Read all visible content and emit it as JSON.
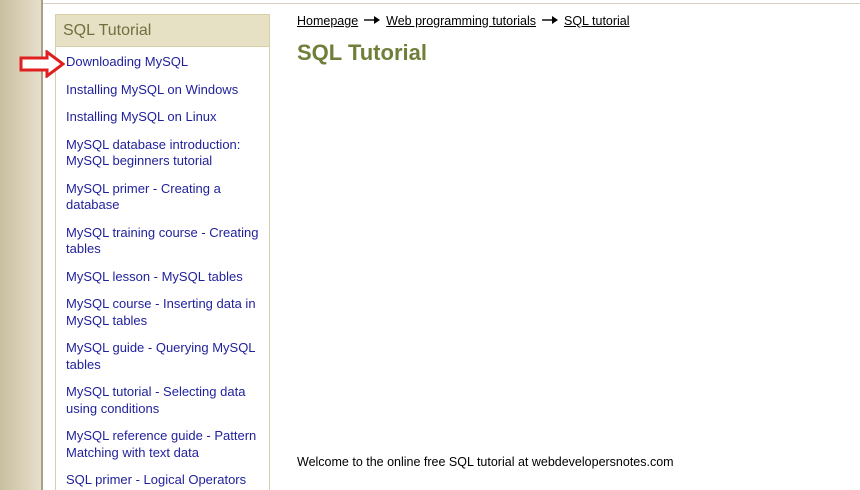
{
  "sidebar": {
    "title": "SQL Tutorial",
    "items": [
      {
        "label": "Downloading MySQL"
      },
      {
        "label": "Installing MySQL on Windows"
      },
      {
        "label": "Installing MySQL on Linux"
      },
      {
        "label": "MySQL database introduction: MySQL beginners tutorial"
      },
      {
        "label": "MySQL primer - Creating a database"
      },
      {
        "label": "MySQL training course - Creating tables"
      },
      {
        "label": "MySQL lesson - MySQL tables"
      },
      {
        "label": "MySQL course - Inserting data in MySQL tables"
      },
      {
        "label": "MySQL guide - Querying MySQL tables"
      },
      {
        "label": "MySQL tutorial - Selecting data using conditions"
      },
      {
        "label": "MySQL reference guide - Pattern Matching with text data"
      },
      {
        "label": "SQL primer - Logical Operators"
      }
    ]
  },
  "annotation": {
    "icon": "red-arrow-right-icon",
    "color": "#e02020"
  },
  "breadcrumb": {
    "items": [
      {
        "label": "Homepage"
      },
      {
        "label": "Web programming tutorials"
      },
      {
        "label": "SQL tutorial"
      }
    ],
    "separator_icon": "long-arrow-right-icon"
  },
  "main": {
    "title": "SQL Tutorial",
    "welcome": "Welcome to the online free SQL tutorial at webdevelopersnotes.com"
  },
  "colors": {
    "link": "#1f1f9b",
    "title": "#6f7f3a",
    "sidebar_header_bg": "#e6e1c4",
    "sidebar_header_text": "#6f6f3f"
  }
}
